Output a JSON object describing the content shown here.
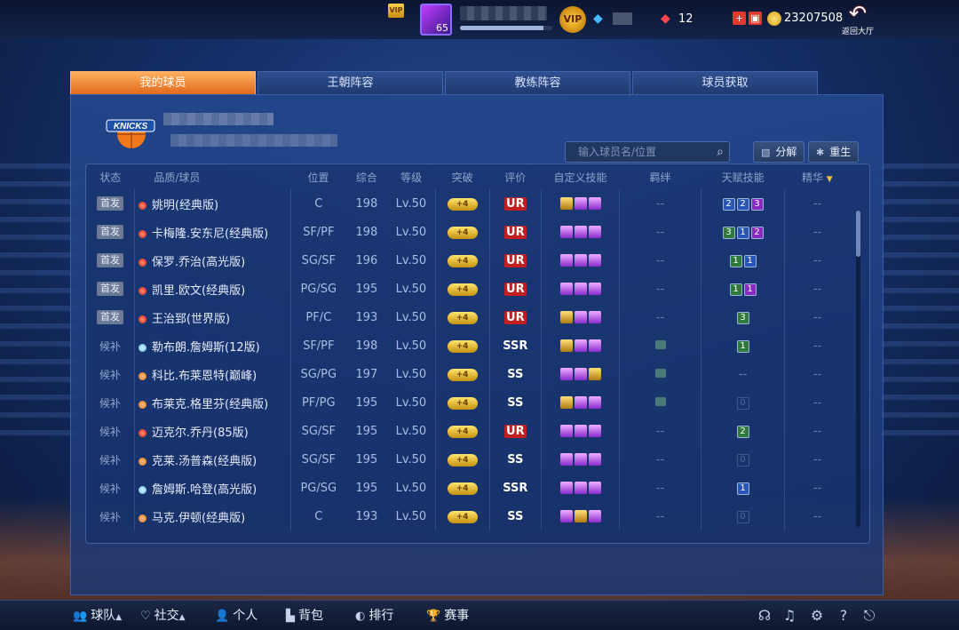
{
  "topbar": {
    "vip_small": "VIP",
    "avatar_level": "65",
    "xp_fraction": 0.9,
    "vip_label": "VIP",
    "red_ticket_count": "12",
    "coins": "23207508",
    "back_label": "返回大厅",
    "icons": [
      "vip-crown-icon",
      "ticket-icon",
      "red-ticket-icon",
      "plus-icon",
      "gift-icon",
      "coin-icon",
      "back-arrow-icon"
    ]
  },
  "tabs": [
    {
      "label": "我的球员",
      "active": true
    },
    {
      "label": "王朝阵容",
      "active": false
    },
    {
      "label": "教练阵容",
      "active": false
    },
    {
      "label": "球员获取",
      "active": false
    }
  ],
  "search": {
    "placeholder": "输入球员名/位置"
  },
  "actions": {
    "decompose": "分解",
    "rebirth": "重生"
  },
  "columns": [
    "状态",
    "品质/球员",
    "位置",
    "综合",
    "等级",
    "突破",
    "评价",
    "自定义技能",
    "羁绊",
    "天赋技能",
    "精华"
  ],
  "breakthrough_label": "+4",
  "rows": [
    {
      "status": "首发",
      "start": true,
      "dot": "red",
      "name": "姚明(经典版)",
      "pos": "C",
      "ovr": "198",
      "lvl": "Lv.50",
      "grade": "UR",
      "skills": [
        "gold",
        "purple",
        "purple"
      ],
      "bond": "--",
      "talents": [
        [
          "2",
          "blue"
        ],
        [
          "2",
          "blue"
        ],
        [
          "3",
          "purple"
        ]
      ],
      "essence": "--"
    },
    {
      "status": "首发",
      "start": true,
      "dot": "red",
      "name": "卡梅隆.安东尼(经典版)",
      "pos": "SF/PF",
      "ovr": "198",
      "lvl": "Lv.50",
      "grade": "UR",
      "skills": [
        "purple",
        "purple",
        "purple"
      ],
      "bond": "--",
      "talents": [
        [
          "3",
          "green"
        ],
        [
          "1",
          "blue"
        ],
        [
          "2",
          "purple"
        ]
      ],
      "essence": "--"
    },
    {
      "status": "首发",
      "start": true,
      "dot": "red",
      "name": "保罗.乔治(高光版)",
      "pos": "SG/SF",
      "ovr": "196",
      "lvl": "Lv.50",
      "grade": "UR",
      "skills": [
        "purple",
        "purple",
        "purple"
      ],
      "bond": "--",
      "talents": [
        [
          "1",
          "green"
        ],
        [
          "1",
          "blue"
        ]
      ],
      "essence": "--"
    },
    {
      "status": "首发",
      "start": true,
      "dot": "red",
      "name": "凯里.欧文(经典版)",
      "pos": "PG/SG",
      "ovr": "195",
      "lvl": "Lv.50",
      "grade": "UR",
      "skills": [
        "purple",
        "purple",
        "purple"
      ],
      "bond": "--",
      "talents": [
        [
          "1",
          "green"
        ],
        [
          "1",
          "purple"
        ]
      ],
      "essence": "--"
    },
    {
      "status": "首发",
      "start": true,
      "dot": "red",
      "name": "王治郅(世界版)",
      "pos": "PF/C",
      "ovr": "193",
      "lvl": "Lv.50",
      "grade": "UR",
      "skills": [
        "gold",
        "purple",
        "purple"
      ],
      "bond": "--",
      "talents": [
        [
          "3",
          "green"
        ]
      ],
      "essence": "--"
    },
    {
      "status": "候补",
      "start": false,
      "dot": "blue",
      "name": "勒布朗.詹姆斯(12版)",
      "pos": "SF/PF",
      "ovr": "198",
      "lvl": "Lv.50",
      "grade": "SSR",
      "skills": [
        "gold",
        "purple",
        "purple"
      ],
      "bond": "icon",
      "talents": [
        [
          "1",
          "green"
        ]
      ],
      "essence": "--"
    },
    {
      "status": "候补",
      "start": false,
      "dot": "orange",
      "name": "科比.布莱恩特(巅峰)",
      "pos": "SG/PG",
      "ovr": "197",
      "lvl": "Lv.50",
      "grade": "SS",
      "skills": [
        "purple",
        "purple",
        "gold"
      ],
      "bond": "icon",
      "talents": [],
      "talent_text": "--",
      "essence": "--"
    },
    {
      "status": "候补",
      "start": false,
      "dot": "orange",
      "name": "布莱克.格里芬(经典版)",
      "pos": "PF/PG",
      "ovr": "195",
      "lvl": "Lv.50",
      "grade": "SS",
      "skills": [
        "gold",
        "purple",
        "purple"
      ],
      "bond": "icon",
      "talents": [
        [
          "0",
          "dim"
        ]
      ],
      "essence": "--"
    },
    {
      "status": "候补",
      "start": false,
      "dot": "red",
      "name": "迈克尔.乔丹(85版)",
      "pos": "SG/SF",
      "ovr": "195",
      "lvl": "Lv.50",
      "grade": "UR",
      "skills": [
        "purple",
        "purple",
        "purple"
      ],
      "bond": "--",
      "talents": [
        [
          "2",
          "green"
        ]
      ],
      "essence": "--"
    },
    {
      "status": "候补",
      "start": false,
      "dot": "orange",
      "name": "克莱.汤普森(经典版)",
      "pos": "SG/SF",
      "ovr": "195",
      "lvl": "Lv.50",
      "grade": "SS",
      "skills": [
        "purple",
        "purple",
        "purple"
      ],
      "bond": "--",
      "talents": [
        [
          "0",
          "dim"
        ]
      ],
      "essence": "--"
    },
    {
      "status": "候补",
      "start": false,
      "dot": "blue",
      "name": "詹姆斯.哈登(高光版)",
      "pos": "PG/SG",
      "ovr": "195",
      "lvl": "Lv.50",
      "grade": "SSR",
      "skills": [
        "purple",
        "purple",
        "purple"
      ],
      "bond": "--",
      "talents": [
        [
          "1",
          "blue"
        ]
      ],
      "essence": "--"
    },
    {
      "status": "候补",
      "start": false,
      "dot": "orange",
      "name": "马克.伊顿(经典版)",
      "pos": "C",
      "ovr": "193",
      "lvl": "Lv.50",
      "grade": "SS",
      "skills": [
        "purple",
        "gold",
        "purple"
      ],
      "bond": "--",
      "talents": [
        [
          "0",
          "dim"
        ]
      ],
      "essence": "--"
    }
  ],
  "bottom_nav": [
    {
      "label": "球队",
      "icon": "players-icon",
      "caret": true
    },
    {
      "label": "社交",
      "icon": "heart-icon",
      "caret": true
    },
    {
      "label": "个人",
      "icon": "person-icon",
      "caret": false
    },
    {
      "label": "背包",
      "icon": "bag-icon",
      "caret": false
    },
    {
      "label": "排行",
      "icon": "rank-icon",
      "caret": false
    },
    {
      "label": "赛事",
      "icon": "trophy-icon",
      "caret": false
    }
  ],
  "bottom_tools": [
    "headset-icon",
    "music-icon",
    "settings-icon",
    "help-icon",
    "exit-icon"
  ]
}
